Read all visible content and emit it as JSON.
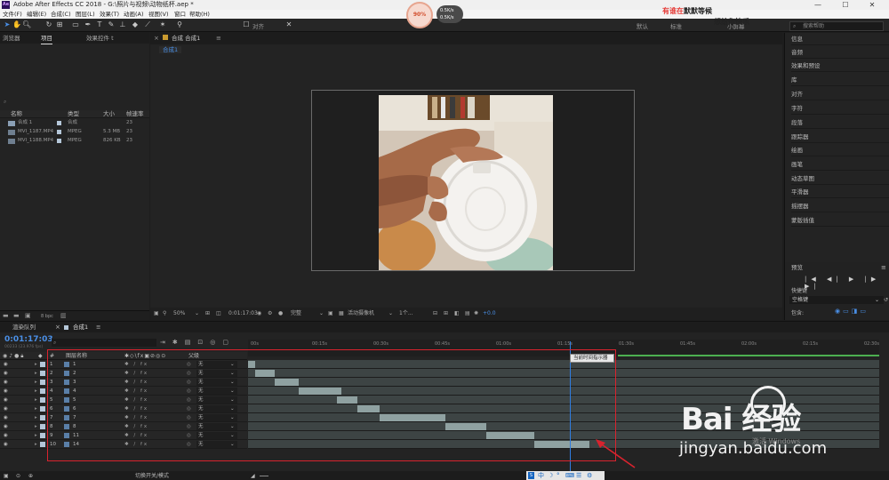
{
  "window": {
    "title": "Adobe After Effects CC 2018 - G:\\照片与视频\\动物纸杯.aep *",
    "controls": [
      "—",
      "☐",
      "✕"
    ]
  },
  "menu": [
    "文件(F)",
    "编辑(E)",
    "合成(C)",
    "图层(L)",
    "效果(T)",
    "动画(A)",
    "视图(V)",
    "窗口",
    "帮助(H)"
  ],
  "overlay": {
    "percent": "90%",
    "speed_up": "0.5K/s",
    "speed_down": "0.5K/s",
    "red_line1_a": "有谁在",
    "red_line1_b": "默默等候",
    "line2": "想给你快乐"
  },
  "toolbar": {
    "align_label": "对齐",
    "workspaces": [
      "默认",
      "标准",
      "小屏幕"
    ],
    "search_placeholder": "搜索帮助"
  },
  "project": {
    "tabs": [
      "浏览器",
      "项目",
      "效果控件 t"
    ],
    "columns": [
      "名称",
      "类型",
      "大小",
      "帧速率"
    ],
    "items": [
      {
        "name": "合成 1",
        "type": "合成",
        "size": "",
        "fps": "23"
      },
      {
        "name": "MVI_1187.MP4",
        "type": "MPEG",
        "size": "5.3 MB",
        "fps": "23"
      },
      {
        "name": "MVI_1188.MP4",
        "type": "MPEG",
        "size": "826 KB",
        "fps": "23"
      }
    ],
    "bpc": "8 bpc"
  },
  "comp": {
    "tab": "合成 合成1",
    "subtab": "合成1",
    "zoom": "50%",
    "time": "0:01:17:03",
    "quality": "完整",
    "camera": "活动摄像机",
    "views": "1个...",
    "offset": "+0.0"
  },
  "right_panel": {
    "items": [
      "信息",
      "音频",
      "效果和预设",
      "库",
      "对齐",
      "字符",
      "段落",
      "跟踪器",
      "绘画",
      "画笔",
      "动态草图",
      "平滑器",
      "摇摆器",
      "蒙版插值"
    ],
    "preview_title": "预览",
    "preview_controls": "|◀ ◀| ▶ |▶ ▶|",
    "shortcut_label": "快捷键",
    "shortcut_value": "空格键",
    "include_label": "包含:"
  },
  "timeline": {
    "tabs": [
      "渲染队列",
      "合成1"
    ],
    "timecode": "0:01:17:03",
    "timecode_sub": "00233 (23.976 fps)",
    "layer_columns": [
      "#",
      "图层名称",
      "父级"
    ],
    "ruler_ticks": [
      "00s",
      "00:15s",
      "00:30s",
      "00:45s",
      "01:00s",
      "01:15s",
      "01:30s",
      "01:45s",
      "02:00s",
      "02:15s",
      "02:30s"
    ],
    "playhead_tooltip": "当前时间指示器",
    "bottom_label": "切换开关/模式",
    "layers": [
      {
        "num": "1",
        "name": "1",
        "parent": "无"
      },
      {
        "num": "2",
        "name": "2",
        "parent": "无"
      },
      {
        "num": "3",
        "name": "3",
        "parent": "无"
      },
      {
        "num": "4",
        "name": "4",
        "parent": "无"
      },
      {
        "num": "5",
        "name": "5",
        "parent": "无"
      },
      {
        "num": "6",
        "name": "6",
        "parent": "无"
      },
      {
        "num": "7",
        "name": "7",
        "parent": "无"
      },
      {
        "num": "8",
        "name": "8",
        "parent": "无"
      },
      {
        "num": "9",
        "name": "11",
        "parent": "无"
      },
      {
        "num": "10",
        "name": "14",
        "parent": "无"
      }
    ]
  },
  "watermark": {
    "logo": "Bai 经验",
    "url": "jingyan.baidu.com",
    "activate": "激活 Windows"
  },
  "tray": [
    "中",
    "☽",
    "°",
    "⌨",
    "☰",
    "⚙"
  ]
}
